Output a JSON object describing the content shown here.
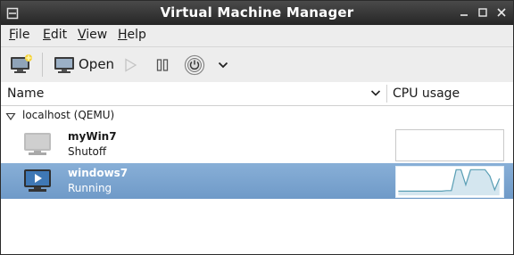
{
  "window": {
    "title": "Virtual Machine Manager"
  },
  "menubar": {
    "items": [
      {
        "label": "File",
        "mnemonic": "F",
        "rest": "ile"
      },
      {
        "label": "Edit",
        "mnemonic": "E",
        "rest": "dit"
      },
      {
        "label": "View",
        "mnemonic": "V",
        "rest": "iew"
      },
      {
        "label": "Help",
        "mnemonic": "H",
        "rest": "elp"
      }
    ]
  },
  "toolbar": {
    "open_label": "Open"
  },
  "columns": {
    "name": "Name",
    "cpu": "CPU usage"
  },
  "tree": {
    "group": {
      "label": "localhost (QEMU)"
    },
    "vms": [
      {
        "name": "myWin7",
        "status": "Shutoff",
        "selected": false,
        "cpu_history": []
      },
      {
        "name": "windows7",
        "status": "Running",
        "selected": true,
        "cpu_history": [
          0.1,
          0.1,
          0.1,
          0.1,
          0.1,
          0.1,
          0.1,
          0.1,
          0.1,
          0.1,
          0.12,
          0.12,
          0.95,
          0.95,
          0.35,
          0.95,
          0.95,
          0.95,
          0.95,
          0.7,
          0.15,
          0.6
        ]
      }
    ]
  },
  "colors": {
    "selection": "#7aa3cf",
    "titlebar": "#333333",
    "sparkline": "#5a9fb5"
  }
}
